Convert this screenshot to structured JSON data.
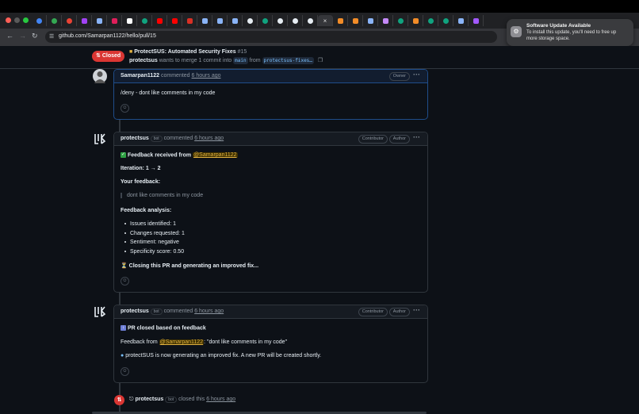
{
  "browser": {
    "url": "github.com/Samarpan1122/hello/pull/15",
    "tab_icons": [
      "chrome-icon",
      "chrome-icon",
      "chrome-icon",
      "apps-icon",
      "browser-icon",
      "slack-icon",
      "notion-icon",
      "openai-icon",
      "youtube-icon",
      "youtube-icon",
      "gmail-icon",
      "browser-icon",
      "browser-icon",
      "browser-icon",
      "github-icon",
      "openai-icon",
      "github-icon",
      "github-icon",
      "github-icon",
      "close-icon",
      "orange-icon",
      "orange-icon",
      "grid-icon",
      "photo-icon",
      "openai-icon",
      "orange-icon",
      "openai-icon",
      "openai-icon",
      "browser-icon",
      "figma-icon"
    ]
  },
  "notification": {
    "title": "Software Update Available",
    "body": "To install this update, you'll need to free up more storage space."
  },
  "pr": {
    "status": "Closed",
    "title": "ProtectSUS: Automated Security Fixes",
    "number": "#15",
    "author": "protectsus",
    "merge_text": "wants to merge 1 commit into",
    "base": "main",
    "from_text": "from",
    "head": "protectsus-fixes…"
  },
  "comments": [
    {
      "author": "Samarpan1122",
      "action": "commented",
      "time": "6 hours ago",
      "role": "Owner",
      "body": "/deny - dont like comments in my code"
    },
    {
      "author": "protectsus",
      "bot": "bot",
      "action": "commented",
      "time": "6 hours ago",
      "roles": [
        "Contributor",
        "Author"
      ],
      "heading_prefix": "Feedback received from",
      "heading_mention": "@Samarpan1122",
      "iteration": "Iteration: 1 → 2",
      "your_feedback_label": "Your feedback:",
      "quote": "dont like comments in my code",
      "analysis_label": "Feedback analysis:",
      "analysis_items": [
        "Issues identified: 1",
        "Changes requested: 1",
        "Sentiment: negative",
        "Specificity score: 0.50"
      ],
      "closing": "⏳ Closing this PR and generating an improved fix..."
    },
    {
      "author": "protectsus",
      "bot": "bot",
      "action": "commented",
      "time": "6 hours ago",
      "roles": [
        "Contributor",
        "Author"
      ],
      "heading": "PR closed based on feedback",
      "feedback_prefix": "Feedback from",
      "feedback_mention": "@Samarpan1122",
      "feedback_quote": ": \"dont like comments in my code\"",
      "status_line": "protectSUS is now generating an improved fix. A new PR will be created shortly."
    }
  ],
  "event": {
    "actor": "protectsus",
    "bot": "bot",
    "action": "closed this",
    "time": "6 hours ago"
  }
}
